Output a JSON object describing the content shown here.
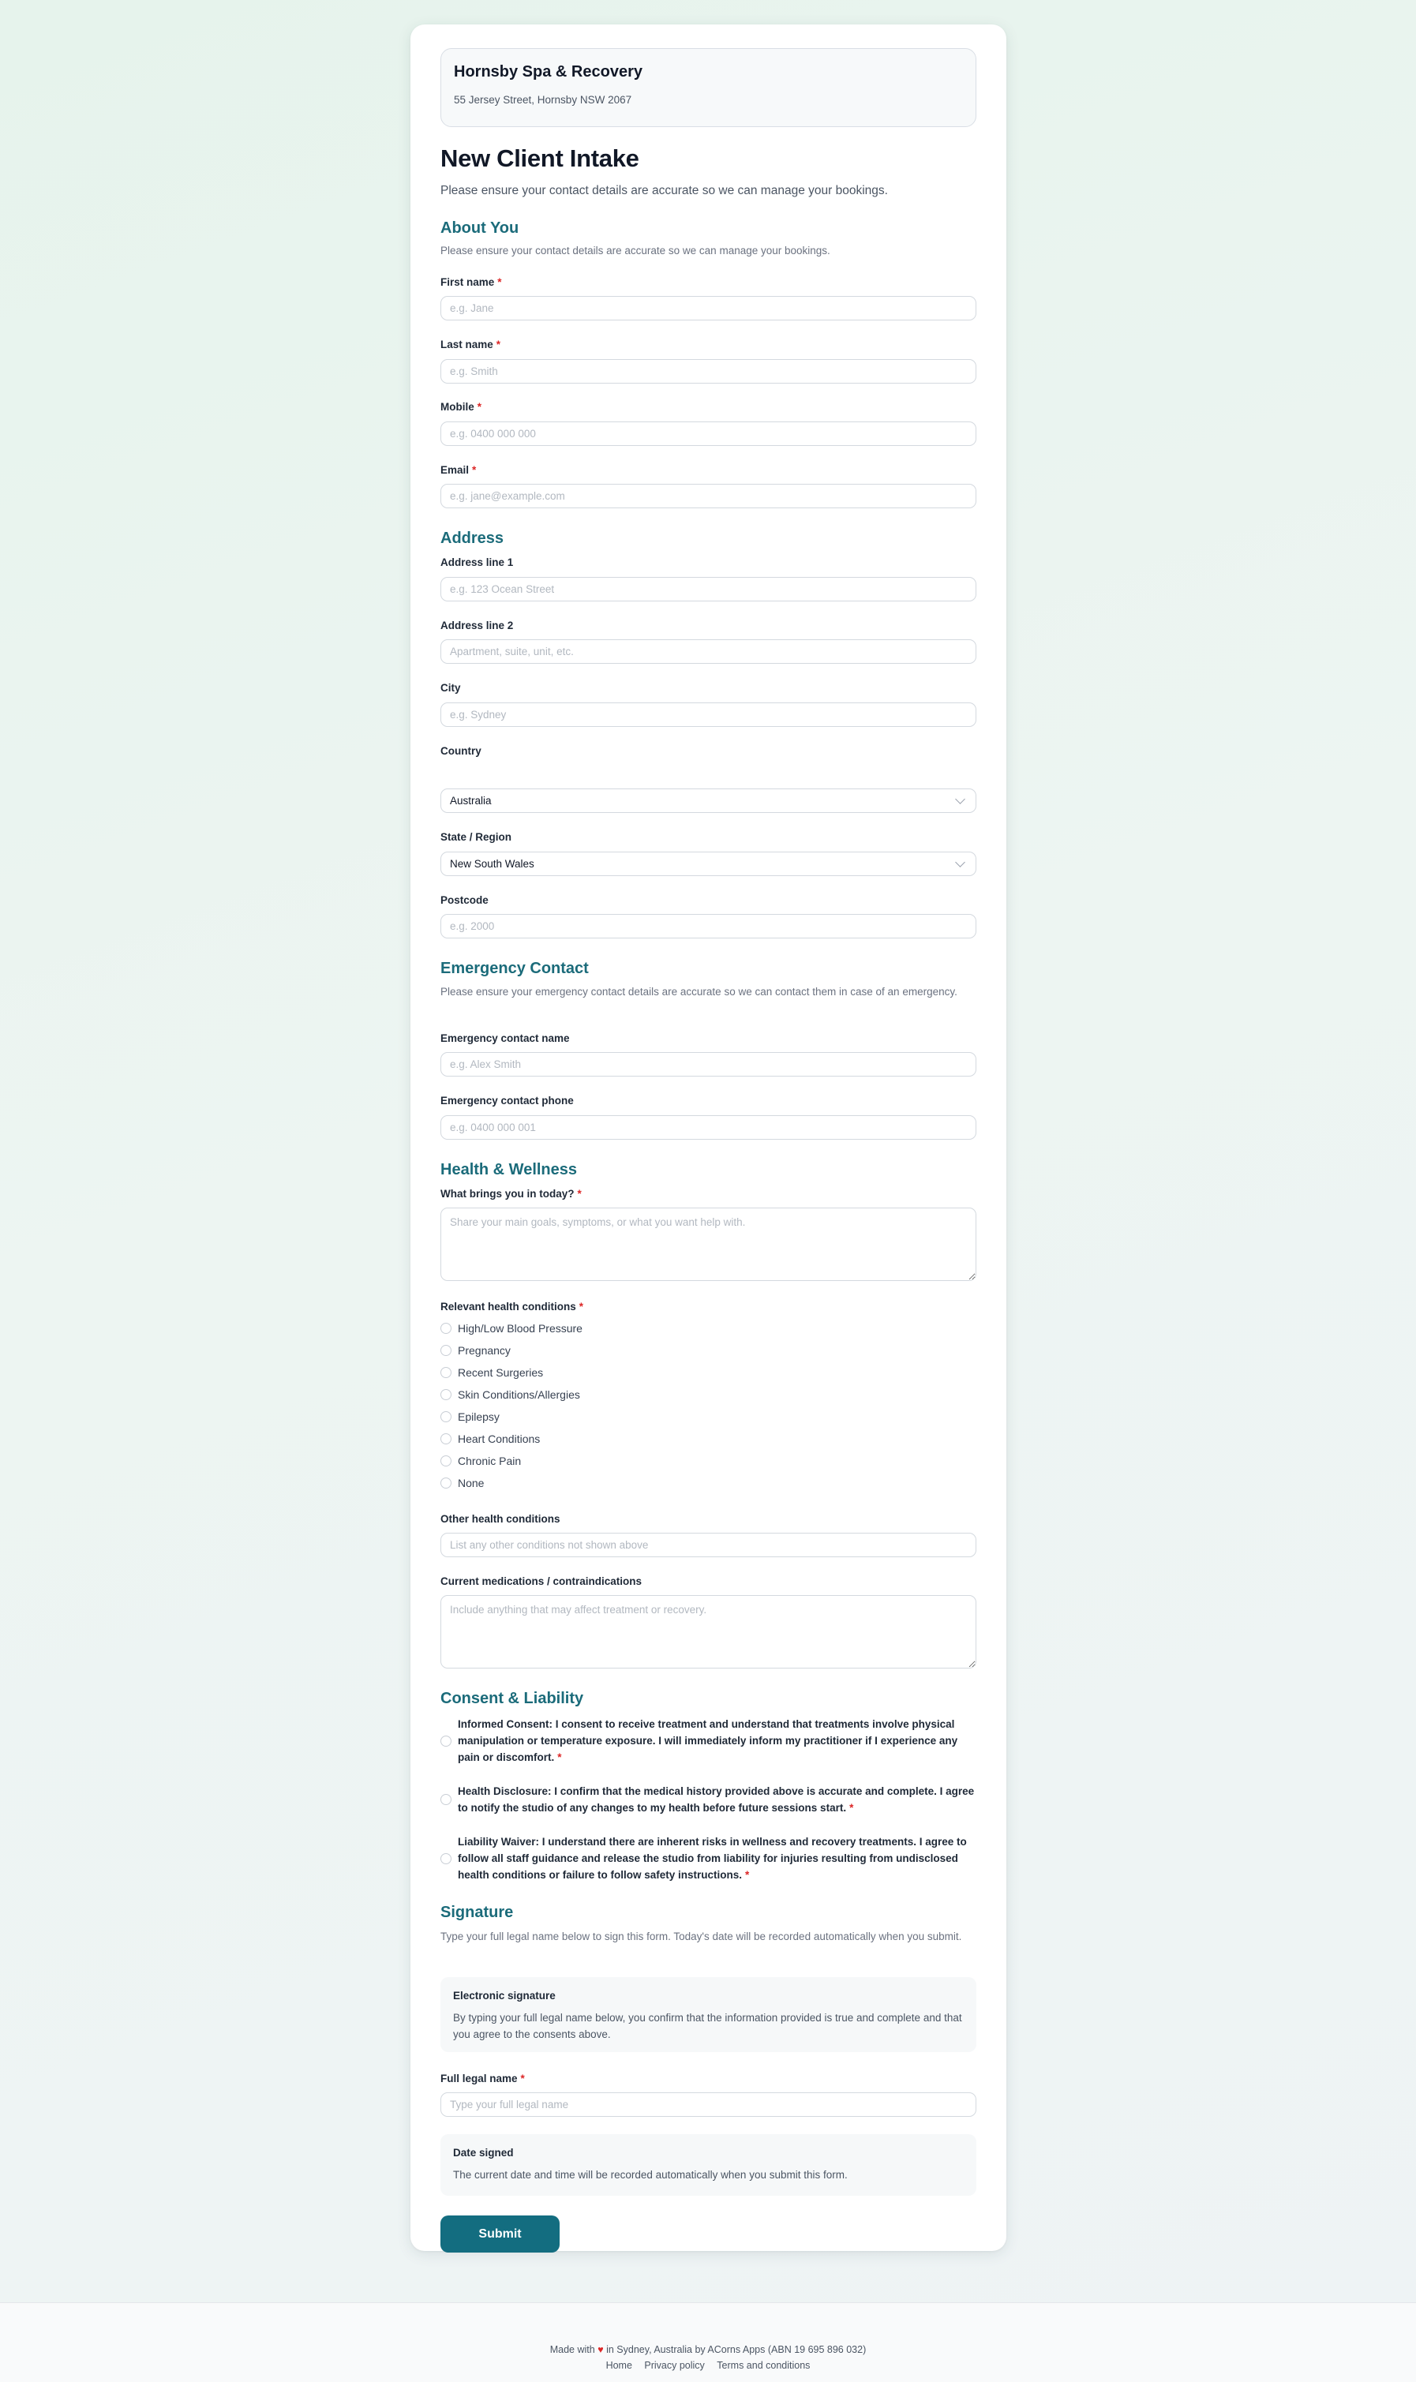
{
  "business": {
    "name": "Hornsby Spa & Recovery",
    "address": "55 Jersey Street, Hornsby NSW 2067"
  },
  "form": {
    "title": "New Client Intake",
    "subtitle": "Please ensure your contact details are accurate so we can manage your bookings."
  },
  "about": {
    "title": "About You",
    "desc": "Please ensure your contact details are accurate so we can manage your bookings.",
    "first_name": {
      "label": "First name",
      "placeholder": "e.g. Jane"
    },
    "last_name": {
      "label": "Last name",
      "placeholder": "e.g. Smith"
    },
    "mobile": {
      "label": "Mobile",
      "placeholder": "e.g. 0400 000 000"
    },
    "email": {
      "label": "Email",
      "placeholder": "e.g. jane@example.com"
    }
  },
  "address": {
    "title": "Address",
    "line1": {
      "label": "Address line 1",
      "placeholder": "e.g. 123 Ocean Street"
    },
    "line2": {
      "label": "Address line 2",
      "placeholder": "Apartment, suite, unit, etc."
    },
    "city": {
      "label": "City",
      "placeholder": "e.g. Sydney"
    },
    "country": {
      "label": "Country",
      "value": "Australia"
    },
    "state": {
      "label": "State / Region",
      "value": "New South Wales"
    },
    "postcode": {
      "label": "Postcode",
      "placeholder": "e.g. 2000"
    }
  },
  "emergency": {
    "title": "Emergency Contact",
    "desc": "Please ensure your emergency contact details are accurate so we can contact them in case of an emergency.",
    "name": {
      "label": "Emergency contact name",
      "placeholder": "e.g. Alex Smith"
    },
    "phone": {
      "label": "Emergency contact phone",
      "placeholder": "e.g. 0400 000 001"
    }
  },
  "health": {
    "title": "Health & Wellness",
    "reason": {
      "label": "What brings you in today?",
      "placeholder": "Share your main goals, symptoms, or what you want help with."
    },
    "conditions_label": "Relevant health conditions",
    "conditions": [
      "High/Low Blood Pressure",
      "Pregnancy",
      "Recent Surgeries",
      "Skin Conditions/Allergies",
      "Epilepsy",
      "Heart Conditions",
      "Chronic Pain",
      "None"
    ],
    "other": {
      "label": "Other health conditions",
      "placeholder": "List any other conditions not shown above"
    },
    "meds": {
      "label": "Current medications / contraindications",
      "placeholder": "Include anything that may affect treatment or recovery."
    }
  },
  "consent": {
    "title": "Consent & Liability",
    "informed": "Informed Consent: I consent to receive treatment and understand that treatments involve physical manipulation or temperature exposure. I will immediately inform my practitioner if I experience any pain or discomfort.",
    "disclosure": "Health Disclosure: I confirm that the medical history provided above is accurate and complete. I agree to notify the studio of any changes to my health before future sessions start.",
    "waiver": "Liability Waiver: I understand there are inherent risks in wellness and recovery treatments. I agree to follow all staff guidance and release the studio from liability for injuries resulting from undisclosed health conditions or failure to follow safety instructions."
  },
  "signature": {
    "title": "Signature",
    "desc": "Type your full legal name below to sign this form. Today's date will be recorded automatically when you submit.",
    "esig_title": "Electronic signature",
    "esig_text": "By typing your full legal name below, you confirm that the information provided is true and complete and that you agree to the consents above.",
    "name": {
      "label": "Full legal name",
      "placeholder": "Type your full legal name"
    },
    "date_title": "Date signed",
    "date_text": "The current date and time will be recorded automatically when you submit this form."
  },
  "required_mark": "*",
  "submit_label": "Submit",
  "footer": {
    "made_prefix": "Made with",
    "heart": "♥",
    "made_suffix": "in Sydney, Australia by ACorns Apps (ABN 19 695 896 032)",
    "links": [
      "Home",
      "Privacy policy",
      "Terms and conditions"
    ]
  }
}
